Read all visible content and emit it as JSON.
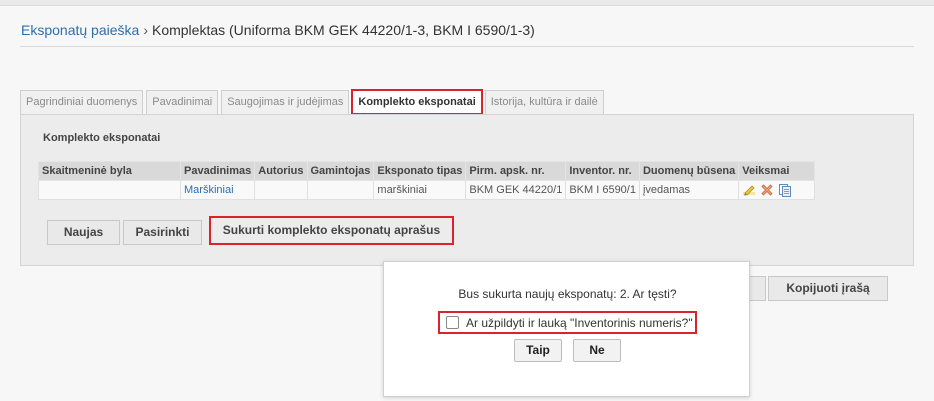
{
  "breadcrumb": {
    "link": "Eksponatų paieška",
    "separator": "›",
    "current": "Komplektas (Uniforma BKM GEK 44220/1-3, BKM I 6590/1-3)"
  },
  "tabs": [
    {
      "label": "Pagrindiniai duomenys"
    },
    {
      "label": "Pavadinimai"
    },
    {
      "label": "Saugojimas ir judėjimas"
    },
    {
      "label": "Komplekto eksponatai"
    },
    {
      "label": "Istorija, kultūra ir dailė"
    }
  ],
  "panel": {
    "title": "Komplekto eksponatai",
    "table": {
      "headers": [
        "Skaitmeninė byla",
        "Pavadinimas",
        "Autorius",
        "Gamintojas",
        "Eksponato tipas",
        "Pirm. apsk. nr.",
        "Inventor. nr.",
        "Duomenų būsena",
        "Veiksmai"
      ],
      "rows": [
        [
          "",
          "Marškiniai",
          "",
          "",
          "marškiniai",
          "BKM GEK 44220/1",
          "BKM I 6590/1",
          "įvedamas"
        ]
      ]
    },
    "buttons": {
      "naujas": "Naujas",
      "pasirinkti": "Pasirinkti",
      "sukurti": "Sukurti komplekto eksponatų aprašus"
    }
  },
  "kopijuoti": "Kopijuoti įrašą",
  "dialog": {
    "message": "Bus sukurta naujų eksponatų: 2. Ar tęsti?",
    "checkbox_label": "Ar užpildyti ir lauką \"Inventorinis numeris?\"",
    "yes": "Taip",
    "no": "Ne"
  },
  "colors": {
    "highlight": "#d9232d",
    "link": "#2a6fb0"
  }
}
